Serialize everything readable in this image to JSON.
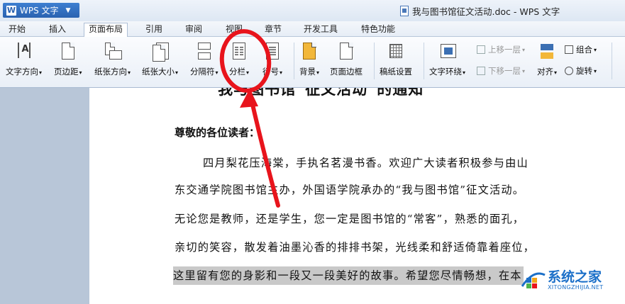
{
  "app": {
    "name": "WPS 文字",
    "logo_letter": "W"
  },
  "window": {
    "title": "我与图书馆征文活动.doc - WPS 文字"
  },
  "menu": {
    "items": [
      "开始",
      "插入",
      "页面布局",
      "引用",
      "审阅",
      "视图",
      "章节",
      "开发工具",
      "特色功能"
    ],
    "active": "页面布局"
  },
  "ribbon": {
    "text_direction": "文字方向",
    "margins": "页边距",
    "orientation": "纸张方向",
    "paper_size": "纸张大小",
    "breaks": "分隔符",
    "columns": "分栏",
    "line_numbers": "行号",
    "background": "背景",
    "page_border": "页面边框",
    "manuscript": "稿纸设置",
    "wrap_text": "文字环绕",
    "bring_forward": "上移一层",
    "send_backward": "下移一层",
    "align": "对齐",
    "group": "组合",
    "rotate": "旋转"
  },
  "document": {
    "heading_partial": "“我与图书馆”征文活动”的通知",
    "greeting": "尊敬的各位读者：",
    "lines": [
      "四月梨花压海棠，手执名茗漫书香。欢迎广大读者积极参与由山",
      "东交通学院图书馆主办，外国语学院承办的“我与图书馆”征文活动。",
      "无论您是教师，还是学生，您一定是图书馆的“常客”，熟悉的面孔，",
      "亲切的笑容，散发着油墨沁香的排排书架，光线柔和舒适倚靠着座位，",
      "这里留有您的身影和一段又一段美好的故事。希望您尽情畅想，在本"
    ]
  },
  "watermark": {
    "name": "系统之家",
    "url": "XITONGZHIJIA.NET"
  },
  "colors": {
    "accent": "#2a62b0",
    "annotation": "#e8141c"
  }
}
